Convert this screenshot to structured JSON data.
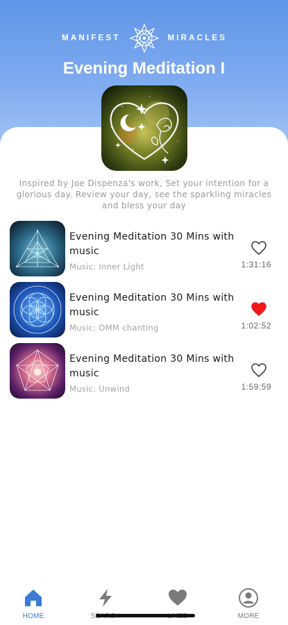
{
  "header": {
    "brand_left": "MANIFEST",
    "brand_right": "MIRACLES",
    "title": "Evening Meditation I",
    "background_color": "#6c9fee"
  },
  "description": "Inspired by Joe Dispenza's work, Set your intention for a glorious day. Review your day, see the sparkling miracles and bless your day",
  "tracks": [
    {
      "title": "Evening Meditation 30 Mins with music",
      "music": "Music: Inner Light",
      "duration": "1:31:16",
      "favorite": false,
      "thumb_icon": "triangle-geometry-icon"
    },
    {
      "title": "Evening Meditation 30 Mins with music",
      "music": "Music: OMM chanting",
      "duration": "1:02:52",
      "favorite": true,
      "thumb_icon": "flower-of-life-icon"
    },
    {
      "title": "Evening Meditation 30 Mins with music",
      "music": "Music: Unwind",
      "duration": "1:59:59",
      "favorite": false,
      "thumb_icon": "pentagon-geometry-icon"
    }
  ],
  "tabbar": {
    "active_color": "#3a7bd5",
    "tabs": [
      {
        "label": "HOME",
        "icon": "home-icon",
        "active": true
      },
      {
        "label": "SEARCH",
        "icon": "lightning-icon",
        "active": false
      },
      {
        "label": "LIKED",
        "icon": "heart-icon",
        "active": false
      },
      {
        "label": "MORE",
        "icon": "user-icon",
        "active": false
      }
    ]
  },
  "favorite_color": "#f01818"
}
